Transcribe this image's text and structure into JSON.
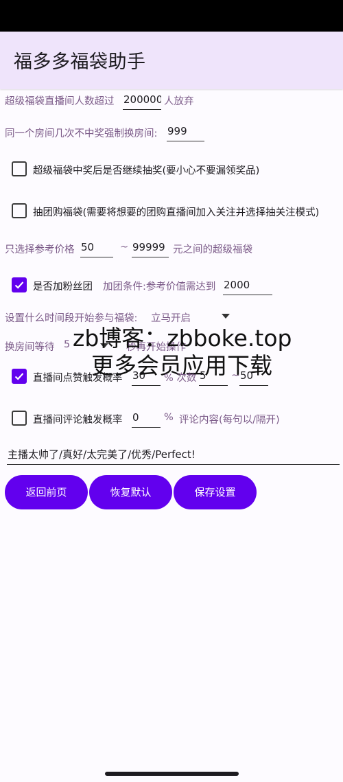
{
  "app": {
    "title": "福多多福袋助手"
  },
  "settings": {
    "viewer_limit": {
      "prefix": "超级福袋直播间人数超过",
      "value": "200000",
      "suffix": "人放弃"
    },
    "force_switch": {
      "prefix": "同一个房间几次不中奖强制换房间:",
      "value": "999"
    },
    "continue_after_win": {
      "label": "超级福袋中奖后是否继续抽奖(要小心不要漏领奖品)",
      "checked": false
    },
    "group_buy": {
      "label": "抽团购福袋(需要将想要的团购直播间加入关注并选择抽关注模式)",
      "checked": false
    },
    "price_range": {
      "prefix": "只选择参考价格",
      "min": "50",
      "tilde": "~",
      "max": "99999",
      "suffix": "元之间的超级福袋"
    },
    "fan_club": {
      "label": "是否加粉丝团",
      "checked": true,
      "cond_label": "加团条件:参考价值需达到",
      "cond_value": "2000"
    },
    "start_time": {
      "label": "设置什么时间段开始参与福袋:",
      "value": "立马开启"
    },
    "switch_wait": {
      "prefix": "换房间等待",
      "value": "5",
      "suffix": "秒再开始操作"
    },
    "like": {
      "label": "直播间点赞触发概率",
      "checked": true,
      "rate": "30",
      "count_label": "% 次数",
      "min": "5",
      "tilde": "~",
      "max": "50"
    },
    "comment": {
      "label": "直播间评论触发概率",
      "checked": false,
      "rate": "0",
      "pct": "%",
      "content_label": "评论内容(每句以/隔开)",
      "content": "主播太帅了/真好/太完美了/优秀/Perfect!"
    }
  },
  "buttons": {
    "back": "返回前页",
    "reset": "恢复默认",
    "save": "保存设置"
  },
  "watermark": {
    "line1": "zb博客：zbboke.top",
    "line2": "更多会员应用下载"
  },
  "colors": {
    "accent": "#6200ee",
    "app_bar": "#efe4fb",
    "label": "#7b5a88"
  }
}
